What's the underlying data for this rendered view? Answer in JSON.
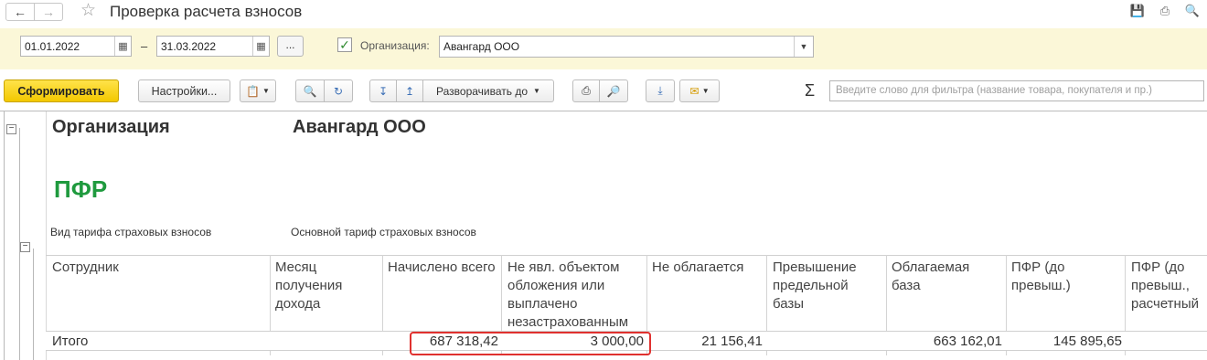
{
  "window": {
    "title": "Проверка расчета взносов"
  },
  "filters": {
    "date_from": "01.01.2022",
    "date_to": "31.03.2022",
    "dash": "–",
    "dots_label": "...",
    "org_checked": true,
    "org_label": "Организация:",
    "org_value": "Авангард ООО"
  },
  "toolbar": {
    "generate_label": "Сформировать",
    "settings_label": "Настройки...",
    "expand_label": "Разворачивать до",
    "search_placeholder": "Введите слово для фильтра (название товара, покупателя и пр.)",
    "sigma": "Σ"
  },
  "report": {
    "org_label": "Организация",
    "org_value": "Авангард ООО",
    "section_title": "ПФР",
    "tariff_label": "Вид тарифа страховых взносов",
    "tariff_value": "Основной тариф страховых взносов",
    "columns": [
      "Сотрудник",
      "Месяц получения дохода",
      "Начислено всего",
      "Не явл. объектом обложения или выплачено незастрахованным",
      "Не облагается",
      "Превышение предельной базы",
      "Облагаемая база",
      "ПФР (до превыш.)",
      "ПФР (до превыш., расчетный"
    ],
    "total": {
      "label": "Итого",
      "accrued": "687 318,42",
      "not_object": "3 000,00",
      "not_taxed": "21 156,41",
      "taxable_base": "663 162,01",
      "pfr": "145 895,65"
    }
  },
  "colors": {
    "accent_yellow": "#f3c800",
    "filter_bg": "#fbf7d8",
    "section_green": "#1f9a3e",
    "highlight_red": "#e0312f"
  }
}
